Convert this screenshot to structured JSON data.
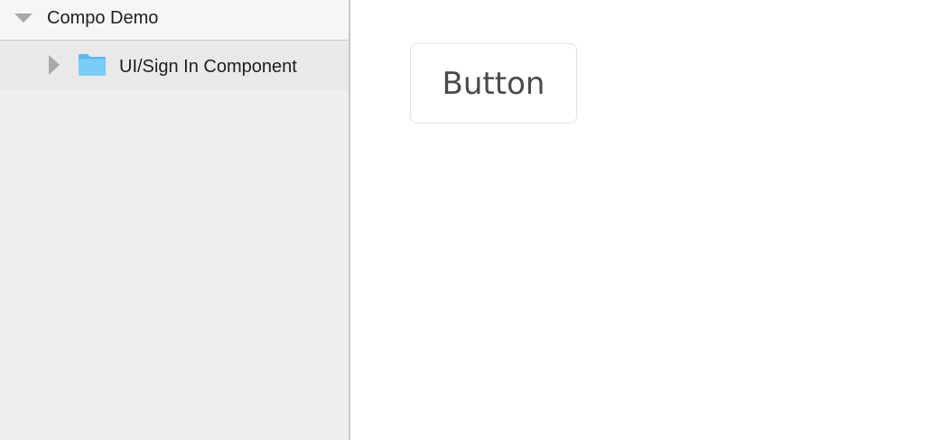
{
  "sidebar": {
    "root": {
      "label": "Compo Demo",
      "icon": "disclosure-triangle-down-icon",
      "expanded": true
    },
    "items": [
      {
        "label": "UI/Sign In Component",
        "disclosure_icon": "disclosure-triangle-right-icon",
        "icon": "folder-icon",
        "expanded": false
      }
    ]
  },
  "canvas": {
    "button_label": "Button"
  },
  "colors": {
    "sidebar_bg": "#efefef",
    "folder": "#6cc2f7",
    "disclosure": "#a9a9a9",
    "button_border": "#e3e3e3",
    "button_text": "#4a4a4a"
  }
}
